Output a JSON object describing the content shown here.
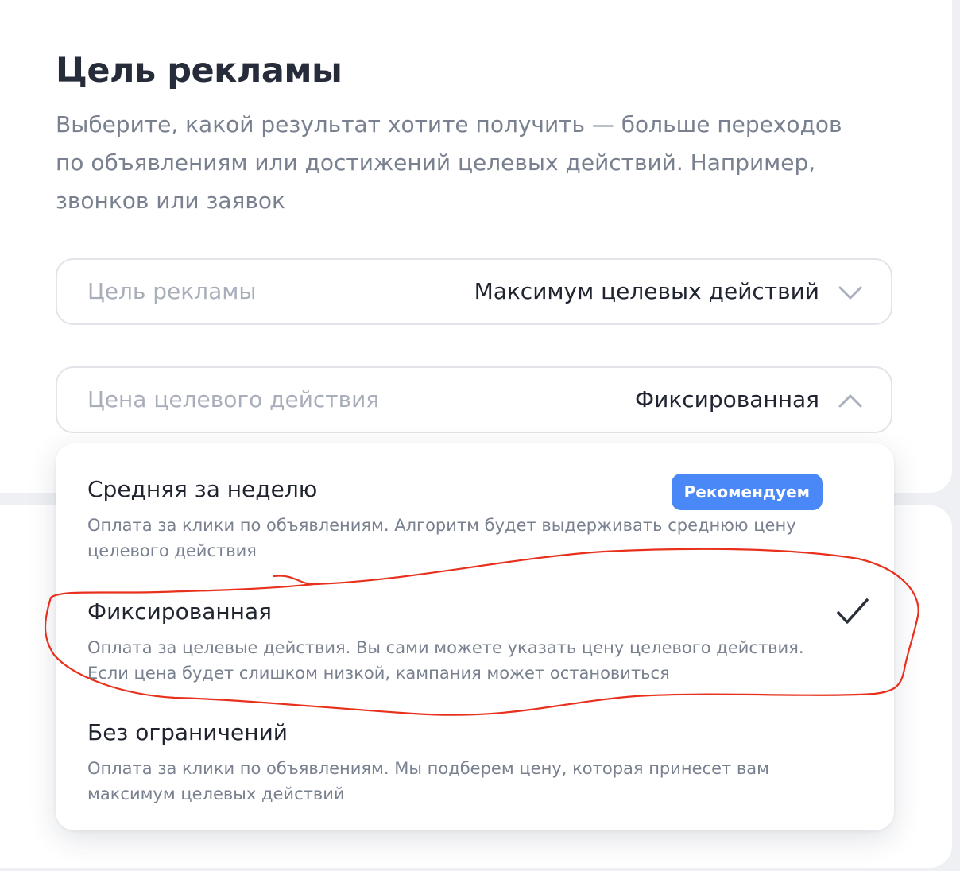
{
  "header": {
    "title": "Цель рекламы",
    "subtitle": "Выберите, какой результат хотите получить — больше переходов по объявлениям или достижений целевых действий. Например, звонков или заявок"
  },
  "goal_select": {
    "label": "Цель рекламы",
    "value": "Максимум целевых действий",
    "icon": "chevron-down-icon"
  },
  "price_select": {
    "label": "Цена целевого действия",
    "value": "Фиксированная",
    "icon": "chevron-up-icon",
    "expanded": true
  },
  "options": [
    {
      "title": "Средняя за неделю",
      "description": "Оплата за клики по объявлениям. Алгоритм будет выдерживать среднюю цену целевого действия",
      "badge": "Рекомендуем",
      "selected": false
    },
    {
      "title": "Фиксированная",
      "description": "Оплата за целевые действия. Вы сами можете указать цену целевого действия. Если цена будет слишком низкой, кампания может остановиться",
      "selected": true,
      "icon": "checkmark-icon"
    },
    {
      "title": "Без ограничений",
      "description": "Оплата за клики по объявлениям. Мы подберем цену, которая принесет вам максимум целевых действий",
      "selected": false
    }
  ],
  "colors": {
    "badge_bg": "#4a88f7",
    "annotation_stroke": "#e8301c",
    "chevron": "#aab0bd",
    "check": "#2a2f3a"
  }
}
